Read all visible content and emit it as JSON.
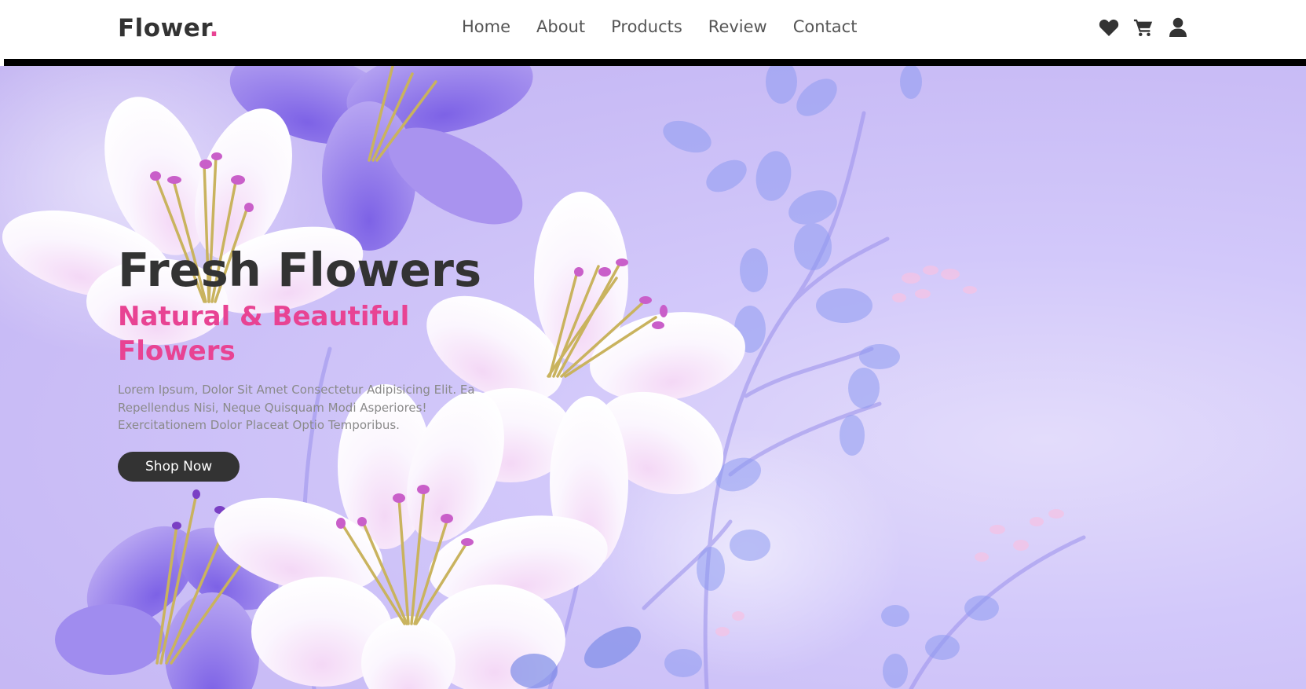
{
  "header": {
    "logo_text": "Flower",
    "logo_dot": ".",
    "nav": [
      {
        "label": "Home"
      },
      {
        "label": "About"
      },
      {
        "label": "Products"
      },
      {
        "label": "Review"
      },
      {
        "label": "Contact"
      }
    ],
    "icons": [
      "heart-icon",
      "cart-icon",
      "user-icon"
    ]
  },
  "hero": {
    "title": "Fresh Flowers",
    "subtitle": "Natural & Beautiful Flowers",
    "description": "Lorem Ipsum, Dolor Sit Amet Consectetur Adipisicing Elit. Ea Repellendus Nisi, Neque Quisquam Modi Asperiores! Exercitationem Dolor Placeat Optio Temporibus.",
    "button_label": "Shop Now"
  },
  "colors": {
    "accent": "#e84393",
    "dark": "#333333",
    "hero_background": "#c9bcf6"
  }
}
